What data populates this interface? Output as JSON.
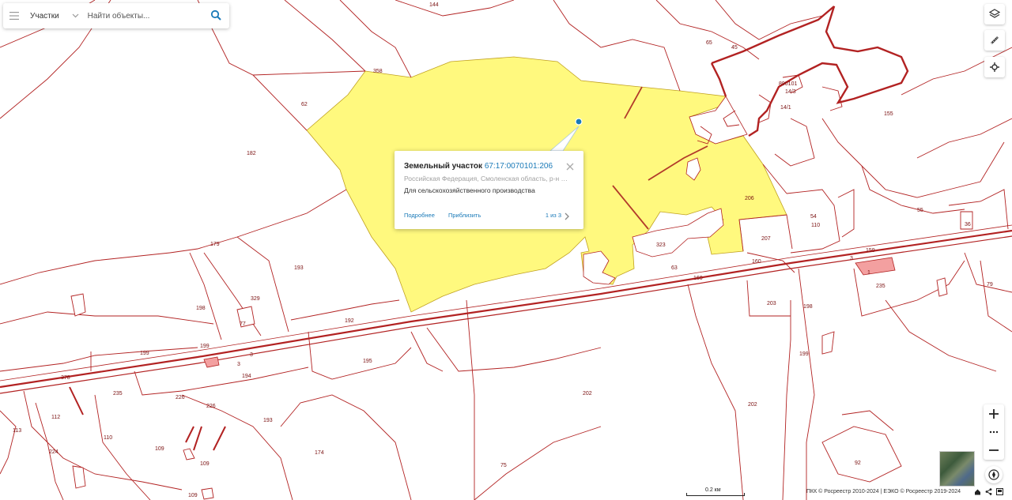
{
  "search": {
    "type_label": "Участки",
    "placeholder": "Найти объекты..."
  },
  "popup": {
    "title": "Земельный участок",
    "cadastral_number": "67:17:0070101:206",
    "address": "Российская Федерация, Смоленская область, р-н Са...",
    "land_use": "Для сельскохозяйственного производства",
    "more_link": "Подробнее",
    "zoom_link": "Приблизить",
    "pager": "1 из 3"
  },
  "toolbar": {
    "layers_icon": "layers-icon",
    "ruler_icon": "ruler-icon",
    "locate_icon": "crosshair-icon"
  },
  "zoom": {
    "plus": "+",
    "more": "•••",
    "minus": "−"
  },
  "scale_label": "0.2 км",
  "copyright": "ПКК © Росреестр 2010-2024 | ЕЭКО © Росреестр 2019-2024",
  "colors": {
    "parcel_border": "#b22222",
    "selected_fill": "#fff97e",
    "link": "#1a7ab8",
    "highway": "#b22222"
  },
  "parcel_labels": [
    "144",
    "65",
    "45",
    "358",
    "62",
    "182",
    "890101",
    "14/3",
    "14/1",
    "155",
    "206",
    "55",
    "110",
    "54",
    "36",
    "207",
    "323",
    "160",
    "159",
    "3",
    "1",
    "235",
    "79",
    "193",
    "179",
    "63",
    "160",
    "203",
    "198",
    "198",
    "329",
    "77",
    "192",
    "199",
    "199",
    "3",
    "3",
    "194",
    "195",
    "378",
    "235",
    "226",
    "226",
    "112",
    "113",
    "110",
    "224",
    "109",
    "109",
    "109",
    "193",
    "174",
    "202",
    "202",
    "199",
    "75",
    "92"
  ]
}
